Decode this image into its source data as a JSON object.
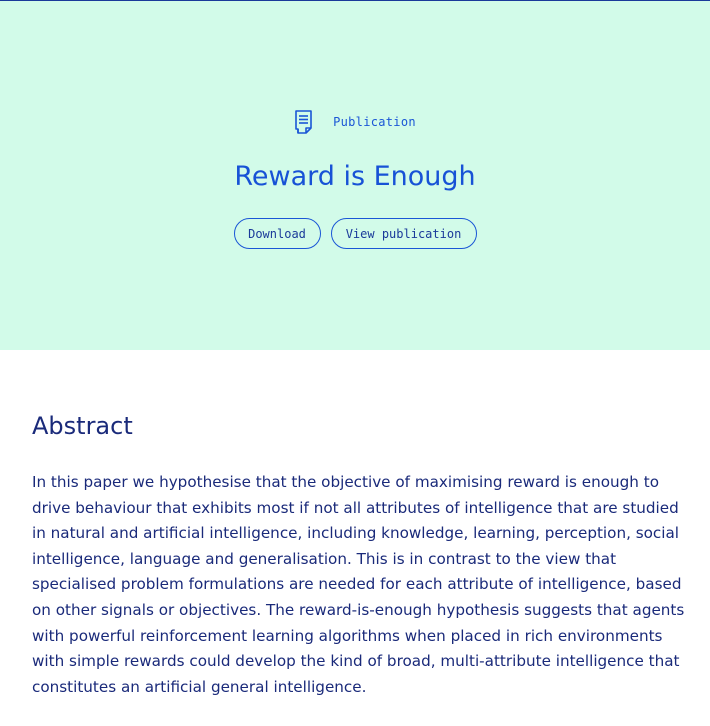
{
  "publication": {
    "kind_label": "Publication",
    "kind_icon": "document-icon",
    "title": "Reward is Enough",
    "actions": {
      "download_label": "Download",
      "view_label": "View publication"
    }
  },
  "abstract": {
    "heading": "Abstract",
    "text": "In this paper we hypothesise that the objective of maximising reward is enough to drive behaviour that exhibits most if not all attributes of intelligence that are studied in natural and artificial intelligence, including knowledge, learning, perception, social intelligence, language and generalisation. This is in contrast to the view that specialised problem formulations are needed for each attribute of intelligence, based on other signals or objectives. The reward-is-enough hypothesis suggests that agents with powerful reinforcement learning algorithms when placed in rich environments with simple rewards could develop the kind of broad, multi-attribute intelligence that constitutes an artificial general intelligence."
  },
  "colors": {
    "hero_background": "#d2fbe9",
    "accent": "#1752d6",
    "text": "#1a2a7a"
  }
}
